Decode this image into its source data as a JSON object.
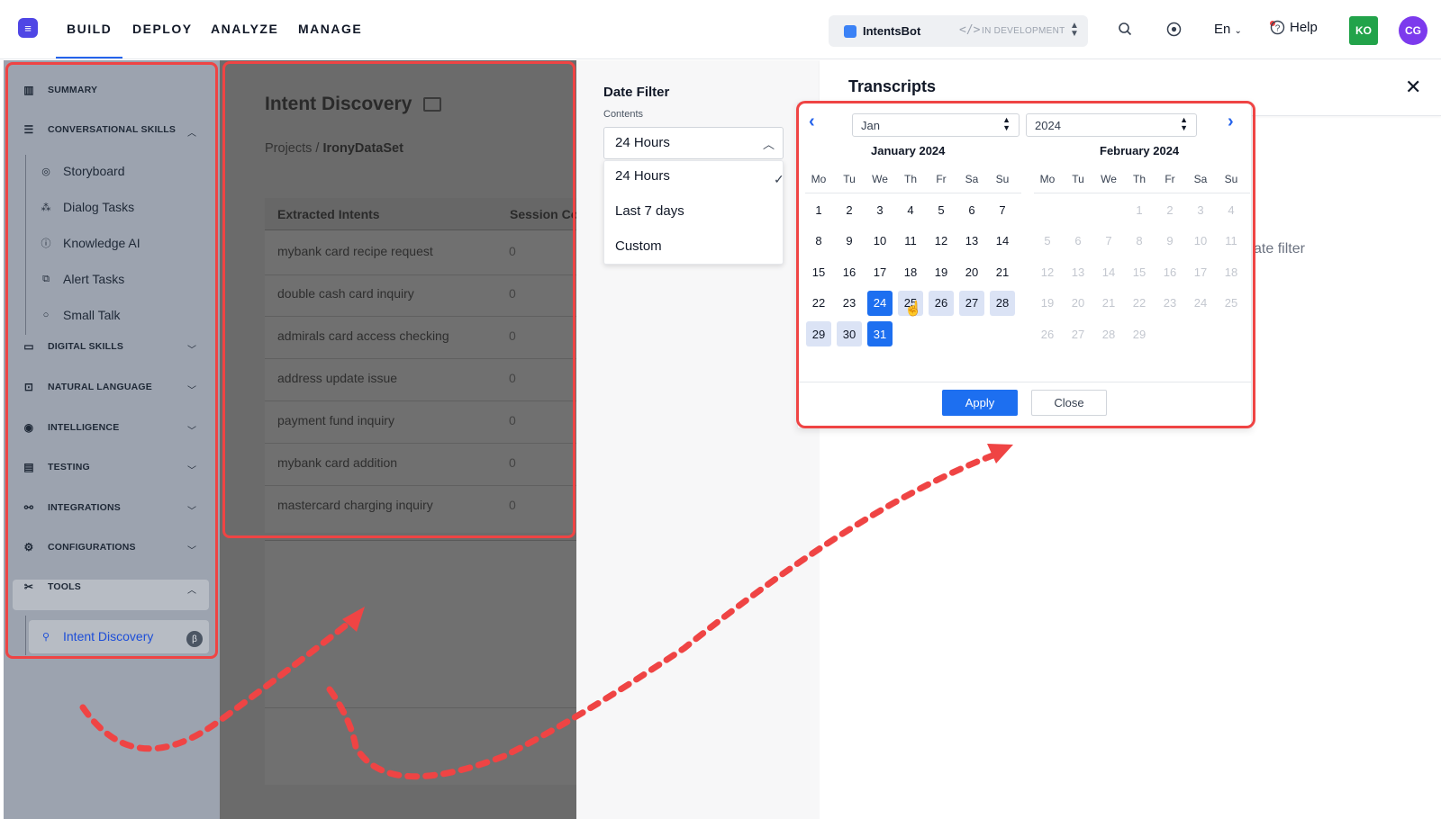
{
  "topbar": {
    "tabs": [
      {
        "label": "BUILD",
        "active": true
      },
      {
        "label": "DEPLOY",
        "active": false
      },
      {
        "label": "ANALYZE",
        "active": false
      },
      {
        "label": "MANAGE",
        "active": false
      }
    ],
    "bot_name": "IntentsBot",
    "bot_status": "IN DEVELOPMENT",
    "language": "En",
    "help_label": "Help",
    "avatars": [
      {
        "initials": "KO",
        "color": "#22a34a"
      },
      {
        "initials": "CG",
        "color": "#7c3aed"
      }
    ],
    "icons": [
      "search-icon",
      "record-icon",
      "help-icon"
    ]
  },
  "sidebar": {
    "items": [
      {
        "label": "SUMMARY",
        "icon": "chart-icon"
      },
      {
        "label": "CONVERSATIONAL SKILLS",
        "icon": "chat-icon",
        "expanded": true
      },
      {
        "label": "DIGITAL SKILLS",
        "icon": "monitor-icon"
      },
      {
        "label": "NATURAL LANGUAGE",
        "icon": "nlp-icon"
      },
      {
        "label": "INTELLIGENCE",
        "icon": "intelligence-icon"
      },
      {
        "label": "TESTING",
        "icon": "clipboard-icon"
      },
      {
        "label": "INTEGRATIONS",
        "icon": "plug-icon"
      },
      {
        "label": "CONFIGURATIONS",
        "icon": "gear-icon"
      },
      {
        "label": "TOOLS",
        "icon": "tools-icon",
        "expanded": true
      }
    ],
    "conversational_sub": [
      "Storyboard",
      "Dialog Tasks",
      "Knowledge AI",
      "Alert Tasks",
      "Small Talk"
    ],
    "tools_sub": [
      "Intent Discovery"
    ],
    "beta_badge": "β"
  },
  "main": {
    "title": "Intent Discovery",
    "breadcrumb_root": "Projects",
    "breadcrumb_sep": "/",
    "breadcrumb_current": "IronyDataSet",
    "columns": [
      "Extracted Intents",
      "Session Co"
    ],
    "rows": [
      {
        "intent": "mybank card recipe request",
        "count": "0"
      },
      {
        "intent": "double cash card inquiry",
        "count": "0"
      },
      {
        "intent": "admirals card access checking",
        "count": "0"
      },
      {
        "intent": "address update issue",
        "count": "0"
      },
      {
        "intent": "payment fund inquiry",
        "count": "0"
      },
      {
        "intent": "mybank card addition",
        "count": "0"
      },
      {
        "intent": "mastercard charging inquiry",
        "count": "0"
      }
    ]
  },
  "date_filter": {
    "title": "Date Filter",
    "label": "Contents",
    "selected": "24 Hours",
    "options": [
      "24 Hours",
      "Last 7 days",
      "Custom"
    ]
  },
  "transcripts": {
    "title": "Transcripts",
    "hint_fragment": "ate filter"
  },
  "calendar": {
    "month_select": "Jan",
    "year_select": "2024",
    "months": [
      {
        "title": "January 2024",
        "offset": 0,
        "days": 31,
        "selected": [
          24,
          31
        ],
        "range": [
          25,
          26,
          27,
          28,
          29,
          30
        ],
        "muted": false
      },
      {
        "title": "February 2024",
        "offset": 3,
        "days": 29,
        "selected": [],
        "range": [],
        "muted": true
      }
    ],
    "weekdays": [
      "Mo",
      "Tu",
      "We",
      "Th",
      "Fr",
      "Sa",
      "Su"
    ],
    "apply_label": "Apply",
    "close_label": "Close"
  }
}
